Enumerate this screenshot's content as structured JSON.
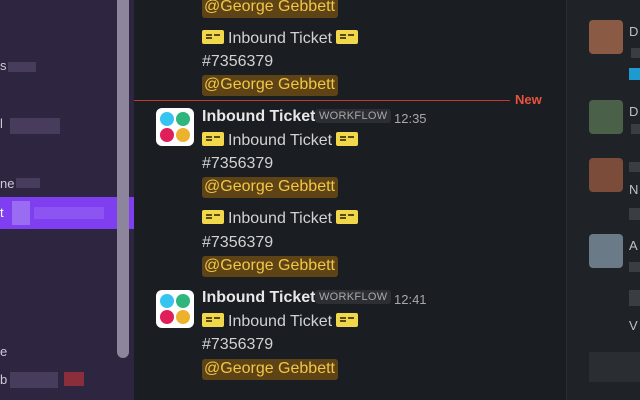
{
  "sidebar": {
    "active_item_fragment": "t",
    "fragments": [
      "s",
      "l",
      "ne",
      "e",
      "b"
    ]
  },
  "messages": {
    "mention_text": "@George Gebbett",
    "ticket_label": "Inbound Ticket",
    "ticket_number": "#7356379",
    "new_label": "New",
    "sender": "Inbound Ticket",
    "workflow_badge": "WORKFLOW",
    "time_1": "12:35",
    "time_2": "12:41",
    "avatar_colors": [
      "#36c5f0",
      "#2eb67d",
      "#e01e5a",
      "#ecb22e"
    ]
  },
  "right_pane": {
    "fragments": [
      "D",
      "D",
      "N",
      "A",
      "V"
    ],
    "accent": "#1d9bd1"
  }
}
